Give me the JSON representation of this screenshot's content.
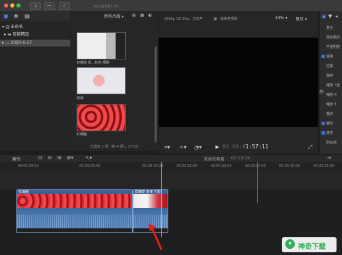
{
  "library": {
    "title": "未命名",
    "items": [
      {
        "label": "智能精选"
      },
      {
        "label": "2020-6-17"
      }
    ]
  },
  "browser": {
    "filter": "所有片段",
    "date_header": "2020年6月17日",
    "clips": [
      {
        "label": "双螺旋 效...粒色 细胞"
      },
      {
        "label": "疾病"
      },
      {
        "label": "红细胞"
      }
    ],
    "selection_status": "已选定 1 项（共 4 项），17:03"
  },
  "viewer": {
    "format": "1080p HD 25p，立体声",
    "project": "未命名项目",
    "zoom": "49%",
    "display": "显示",
    "timecode": "1:57:11"
  },
  "inspector": {
    "sections": [
      {
        "label": "复合",
        "checked": false
      },
      {
        "label": "混合模式",
        "checked": false
      },
      {
        "label": "不透明度",
        "checked": false
      },
      {
        "label": "变换",
        "checked": true
      },
      {
        "label": "位置",
        "checked": false
      },
      {
        "label": "旋转",
        "checked": false
      },
      {
        "label": "缩放（全部）",
        "checked": false
      },
      {
        "label": "缩放 X",
        "checked": false
      },
      {
        "label": "缩放 Y",
        "checked": false
      },
      {
        "label": "锚点",
        "checked": false
      },
      {
        "label": "裁剪",
        "checked": true
      },
      {
        "label": "变形",
        "checked": true
      },
      {
        "label": "防抖动",
        "checked": false
      }
    ]
  },
  "timeline": {
    "index_label": "索引",
    "project_name": "未命名项目",
    "duration": "01:13:19",
    "ruler": [
      "00:00:00:00",
      "00:00:05:00",
      "00:00:10:00",
      "00:00:15:00",
      "00:00:20:00",
      "00:00:25:00",
      "00:00:30:00",
      "00:00:35:00"
    ],
    "clips": [
      {
        "title": "红细胞"
      },
      {
        "title": "双螺旋 效果 光粒"
      }
    ]
  },
  "watermark": "神奇下载",
  "colors": {
    "accent": "#3b6fd6",
    "clip_blue": "#3d5f97",
    "playhead": "#d83a2a"
  }
}
